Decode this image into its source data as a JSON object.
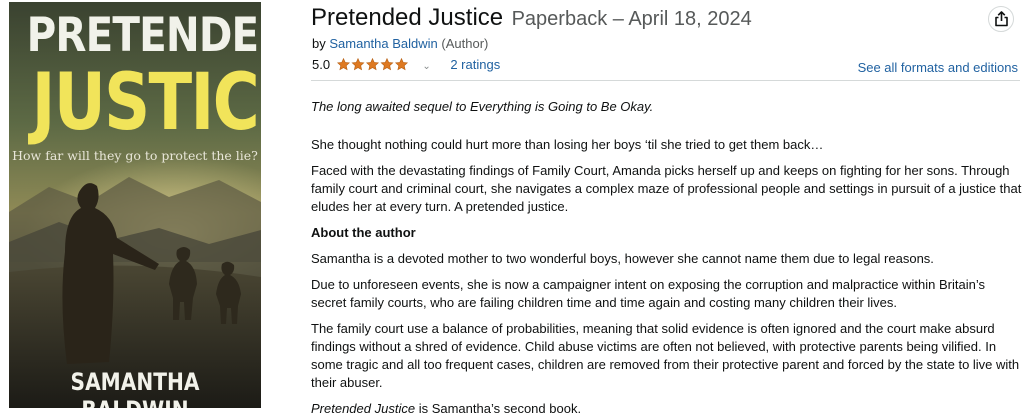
{
  "cover": {
    "title_line1": "PRETENDED",
    "title_line2": "JUSTICE",
    "tagline": "How far will they go to protect the lie?",
    "author": "SAMANTHA BALDWIN"
  },
  "product": {
    "title": "Pretended Justice",
    "format_date": "Paperback – April 18, 2024",
    "by": "by",
    "author": "Samantha Baldwin",
    "author_role": "(Author)",
    "rating_value": "5.0",
    "stars": 5,
    "ratings_count": "2 ratings",
    "see_all_formats": "See all formats and editions"
  },
  "description": {
    "tagline": "The long awaited sequel to Everything is Going to Be Okay.",
    "p1": "She thought nothing could hurt more than losing her boys ‘til she tried to get them back…",
    "p2": "Faced with the devastating findings of Family Court, Amanda picks herself up and keeps on fighting for her sons. Through family court and criminal court, she navigates a complex maze of professional people and settings in pursuit of a justice that eludes her at every turn. A pretended justice.",
    "about_heading": "About the author",
    "a1": "Samantha is a devoted mother to two wonderful boys, however she cannot name them due to legal reasons.",
    "a2": "Due to unforeseen events, she is now a campaigner intent on exposing the corruption and malpractice within Britain’s secret family courts, who are failing children time and time again and costing many children their lives.",
    "a3": "The family court use a balance of probabilities, meaning that solid evidence is often ignored and the court make absurd findings without a shred of evidence. Child abuse victims are often not believed, with protective parents being vilified. In some tragic and all too frequent cases, children are removed from their protective parent and forced by the state to live with their abuser.",
    "last_italic": "Pretended Justice",
    "last_rest": " is Samantha’s second book."
  },
  "colors": {
    "link": "#2162a1",
    "star": "#de7921",
    "cover_title_yellow": "#f1e45a"
  },
  "icons": {
    "share": "share-icon",
    "star": "star-icon",
    "chevron": "chevron-down-icon"
  }
}
